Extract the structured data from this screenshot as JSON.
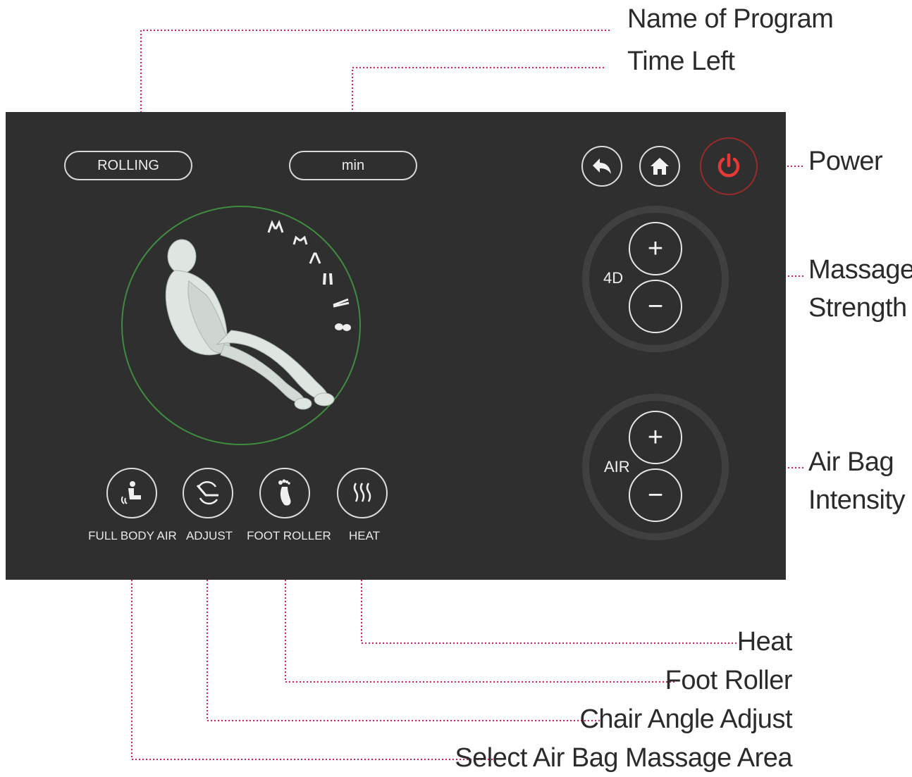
{
  "callouts": {
    "program_name": "Name of Program",
    "time_left": "Time Left",
    "power": "Power",
    "massage_strength_line1": "Massage",
    "massage_strength_line2": "Strength",
    "airbag_intensity_line1": "Air Bag",
    "airbag_intensity_line2": "Intensity",
    "heat": "Heat",
    "foot_roller": "Foot Roller",
    "chair_angle_adjust": "Chair Angle Adjust",
    "airbag_area": "Select Air Bag Massage Area"
  },
  "screen": {
    "program_value": "ROLLING",
    "time_value": "min",
    "strength_dial": {
      "label": "4D",
      "plus": "+",
      "minus": "−"
    },
    "air_dial": {
      "label": "AIR",
      "plus": "+",
      "minus": "−"
    },
    "functions": [
      {
        "label": "FULL BODY AIR",
        "icon": "airbag-seat-icon"
      },
      {
        "label": "ADJUST",
        "icon": "recline-adjust-icon"
      },
      {
        "label": "FOOT ROLLER",
        "icon": "foot-icon"
      },
      {
        "label": "HEAT",
        "icon": "heat-waves-icon"
      }
    ],
    "body_area_icons": [
      "shoulders-icon",
      "upper-back-icon",
      "waist-icon",
      "legs-icon",
      "calves-icon",
      "feet-icon"
    ]
  },
  "colors": {
    "screen_bg": "#2f2f2f",
    "callout_line": "#d81b60",
    "power_red": "#e53935",
    "body_ring_green": "#3f8b3f"
  }
}
